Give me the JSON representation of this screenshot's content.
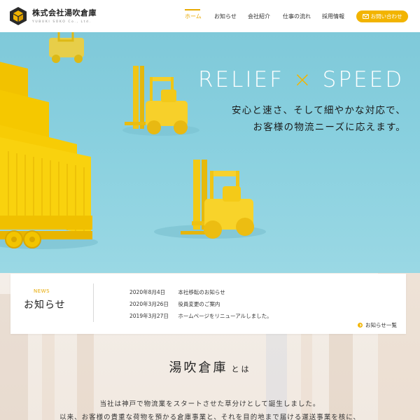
{
  "header": {
    "company_name": "株式会社湯吹倉庫",
    "company_sub": "YUBUKI SOKO Co., Ltd.",
    "logo_icon": "cube-logo-icon",
    "nav": [
      {
        "label": "ホーム",
        "active": true
      },
      {
        "label": "お知らせ",
        "active": false
      },
      {
        "label": "会社紹介",
        "active": false
      },
      {
        "label": "仕事の流れ",
        "active": false
      },
      {
        "label": "採用情報",
        "active": false
      }
    ],
    "contact_label": "お問い合わせ",
    "contact_icon": "mail-icon"
  },
  "hero": {
    "title_left": "RELIEF",
    "title_mid": "×",
    "title_right": "SPEED",
    "copy_line1": "安心と速さ、そして細やかな対応で、",
    "copy_line2": "お客様の物流ニーズに応えます。"
  },
  "news": {
    "eyebrow": "NEWS",
    "heading": "お知らせ",
    "items": [
      {
        "date": "2020年8月4日",
        "title": "本社移転のお知らせ"
      },
      {
        "date": "2020年3月26日",
        "title": "役員変更のご案内"
      },
      {
        "date": "2019年3月27日",
        "title": "ホームページをリニューアルしました。"
      }
    ],
    "more_label": "お知らせ一覧"
  },
  "about": {
    "title_big": "湯吹倉庫",
    "title_small": "とは",
    "line1": "当社は神戸で物流業をスタートさせた草分けとして誕生しました。",
    "line2": "以来、お客様の貴重な荷物を預かる倉庫事業と、それを目的地まで届ける運送事業を核に、"
  },
  "colors": {
    "accent": "#f2b400",
    "hero_bg": "#89d0df",
    "truck": "#f5c400"
  }
}
